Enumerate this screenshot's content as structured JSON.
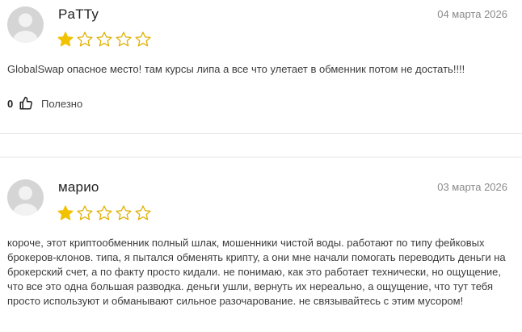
{
  "reviews": [
    {
      "author": "PaTTy",
      "date": "04 марта 2026",
      "rating": 1,
      "max_rating": 5,
      "text": "GlobalSwap опасное место! там курсы липа а все что улетает в обменник потом не достать!!!!",
      "likes": "0",
      "helpful_label": "Полезно"
    },
    {
      "author": "марио",
      "date": "03 марта 2026",
      "rating": 1,
      "max_rating": 5,
      "text": "короче, этот криптообменник полный шлак, мошенники чистой воды. работают по типу фейковых брокеров-клонов. типа, я пытался обменять крипту, а они мне начали помогать переводить деньги на брокерский счет, а по факту просто кидали. не понимаю, как это работает технически, но ощущение, что все это одна большая разводка. деньги ушли, вернуть их нереально, а ощущение, что тут тебя просто используют и обманывают сильное разочарование. не связывайтесь с этим мусором!"
    }
  ],
  "colors": {
    "star_filled": "#f2c200",
    "star_empty_stroke": "#e0b000",
    "avatar_bg": "#d5d5d5",
    "avatar_figure": "#f2f2f2",
    "divider": "#e6e6e6"
  },
  "icons": {
    "star": "star-icon",
    "like": "thumbs-up-icon",
    "avatar": "user-avatar-placeholder"
  }
}
